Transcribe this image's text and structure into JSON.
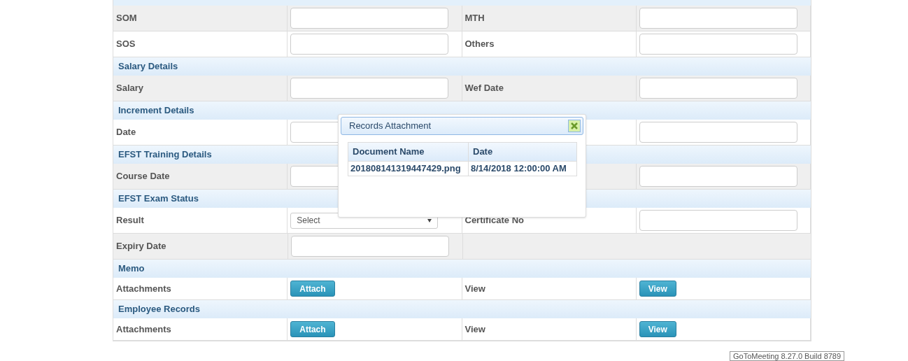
{
  "form": {
    "rows": [
      {
        "kind": "fields",
        "shaded": true,
        "cells": [
          {
            "kind": "label",
            "text": "SOM"
          },
          {
            "kind": "input"
          },
          {
            "kind": "label",
            "text": "MTH"
          },
          {
            "kind": "input"
          }
        ]
      },
      {
        "kind": "fields",
        "shaded": false,
        "cells": [
          {
            "kind": "label",
            "text": "SOS"
          },
          {
            "kind": "input"
          },
          {
            "kind": "label",
            "text": "Others"
          },
          {
            "kind": "input"
          }
        ]
      },
      {
        "kind": "section",
        "title": "Salary Details"
      },
      {
        "kind": "fields",
        "shaded": true,
        "cells": [
          {
            "kind": "label",
            "text": "Salary"
          },
          {
            "kind": "input"
          },
          {
            "kind": "label",
            "text": "Wef Date"
          },
          {
            "kind": "input"
          }
        ]
      },
      {
        "kind": "section",
        "title": "Increment Details"
      },
      {
        "kind": "fields",
        "shaded": false,
        "cells": [
          {
            "kind": "label",
            "text": "Date"
          },
          {
            "kind": "input"
          },
          {
            "kind": "blank"
          },
          {
            "kind": "input"
          }
        ]
      },
      {
        "kind": "section",
        "title": "EFST Training Details"
      },
      {
        "kind": "fields",
        "shaded": true,
        "cells": [
          {
            "kind": "label",
            "text": "Course Date"
          },
          {
            "kind": "input"
          },
          {
            "kind": "blank"
          },
          {
            "kind": "input"
          }
        ]
      },
      {
        "kind": "section",
        "title": "EFST Exam Status"
      },
      {
        "kind": "fields",
        "shaded": false,
        "cells": [
          {
            "kind": "label",
            "text": "Result"
          },
          {
            "kind": "select",
            "value": "Select"
          },
          {
            "kind": "label",
            "text": "Certificate No"
          },
          {
            "kind": "input"
          }
        ]
      },
      {
        "kind": "fields",
        "shaded": true,
        "cells": [
          {
            "kind": "label",
            "text": "Expiry Date"
          },
          {
            "kind": "input"
          },
          {
            "kind": "none"
          }
        ]
      },
      {
        "kind": "section",
        "title": "Memo"
      },
      {
        "kind": "fields",
        "shaded": false,
        "cells": [
          {
            "kind": "label",
            "text": "Attachments"
          },
          {
            "kind": "button",
            "text": "Attach"
          },
          {
            "kind": "label",
            "text": "View"
          },
          {
            "kind": "button",
            "text": "View"
          }
        ]
      },
      {
        "kind": "section",
        "title": "Employee Records"
      },
      {
        "kind": "fields",
        "shaded": false,
        "cells": [
          {
            "kind": "label",
            "text": "Attachments"
          },
          {
            "kind": "button",
            "text": "Attach"
          },
          {
            "kind": "label",
            "text": "View"
          },
          {
            "kind": "button",
            "text": "View"
          }
        ]
      }
    ]
  },
  "dialog": {
    "title": "Records Attachment",
    "columns": [
      "Document Name",
      "Date"
    ],
    "rows": [
      [
        "201808141319447429.png",
        "8/14/2018 12:00:00 AM"
      ]
    ]
  },
  "tooltip": "GoToMeeting 8.27.0 Build 8789"
}
